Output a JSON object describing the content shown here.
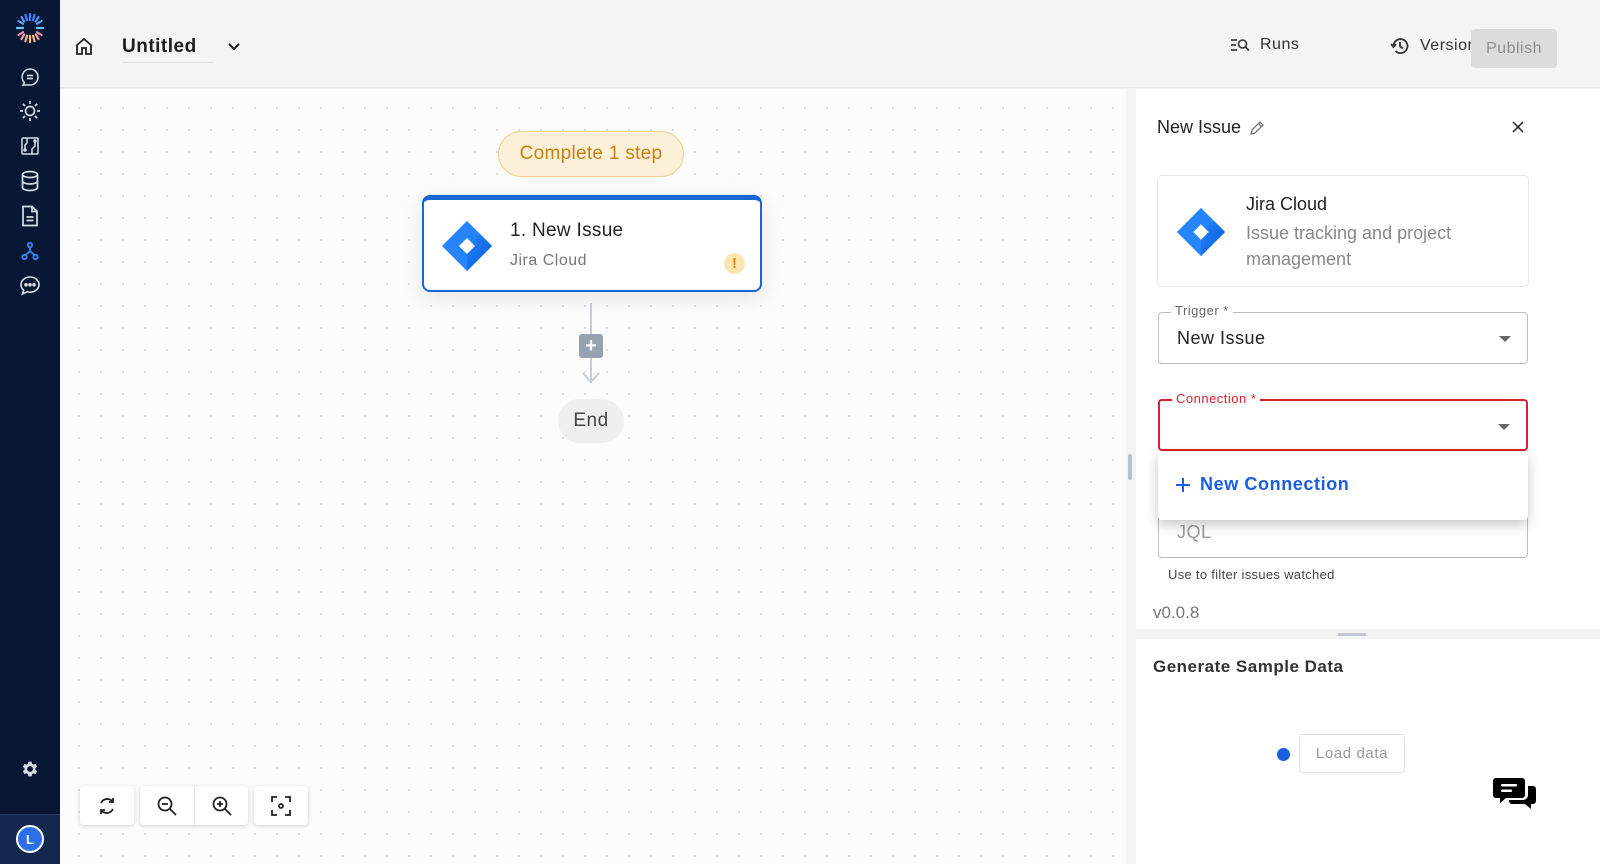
{
  "sidebar": {
    "items": [
      {
        "name": "chat",
        "icon": "chat-bubble-icon",
        "active": false
      },
      {
        "name": "settings-sun",
        "icon": "sun-icon",
        "active": false
      },
      {
        "name": "circuit",
        "icon": "circuit-board-icon",
        "active": false
      },
      {
        "name": "database",
        "icon": "database-icon",
        "active": false
      },
      {
        "name": "document",
        "icon": "document-icon",
        "active": false
      },
      {
        "name": "workflows",
        "icon": "workflow-icon",
        "active": true
      },
      {
        "name": "messages",
        "icon": "message-dots-icon",
        "active": false
      }
    ],
    "settings_icon": "gear-icon",
    "avatar_initial": "L",
    "active_color": "#3b7ff0"
  },
  "header": {
    "title": "Untitled",
    "runs_label": "Runs",
    "versions_label": "Versions",
    "publish_label": "Publish",
    "versions_dot_color": "#f08a34"
  },
  "canvas": {
    "step_badge": "Complete 1 step",
    "node": {
      "title": "1. New Issue",
      "subtitle": "Jira Cloud",
      "warning": "!"
    },
    "add_step": "+",
    "end_label": "End",
    "controls": [
      "refresh-icon",
      "zoom-out-icon",
      "zoom-in-icon",
      "fit-view-icon"
    ]
  },
  "panel": {
    "title": "New Issue",
    "app": {
      "name": "Jira Cloud",
      "description": "Issue tracking and project management"
    },
    "trigger": {
      "label": "Trigger *",
      "value": "New Issue"
    },
    "connection": {
      "label": "Connection *",
      "value": "",
      "dropdown_item": "New Connection"
    },
    "jql": {
      "placeholder": "JQL",
      "helper": "Use to filter issues watched"
    },
    "version": "v0.0.8"
  },
  "sample": {
    "title": "Generate Sample Data",
    "load_label": "Load data"
  }
}
